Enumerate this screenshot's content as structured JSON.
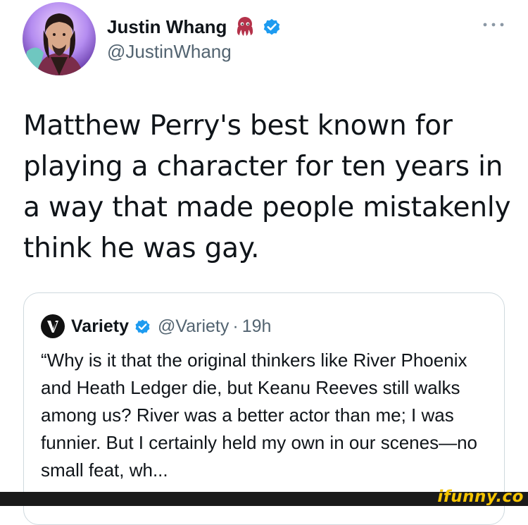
{
  "author": {
    "name": "Justin Whang",
    "handle": "@JustinWhang",
    "emoji_icon": "octopus-icon",
    "verified": true
  },
  "tweet": {
    "text": "Matthew Perry's best known for playing a character for ten years in a way that made people mistakenly think he was gay."
  },
  "quoted": {
    "name": "Variety",
    "handle": "@Variety",
    "separator": "·",
    "time": "19h",
    "verified": true,
    "text": "“Why is it that the original thinkers like River Phoenix and Heath Ledger die, but Keanu Reeves still walks among us? River was a better actor than me; I was funnier. But I certainly held my own in our scenes—no small feat, wh..."
  },
  "watermark": {
    "text": "ifunny.co"
  },
  "colors": {
    "verified_blue": "#1d9bf0",
    "secondary_text": "#536471",
    "border": "#cfd9de",
    "watermark": "#f5c400"
  }
}
